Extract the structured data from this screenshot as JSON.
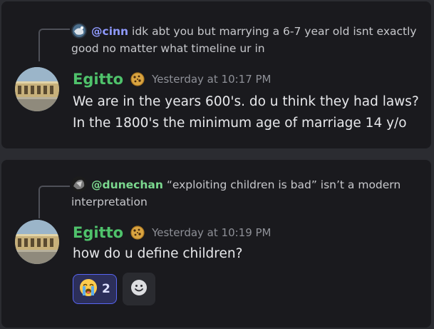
{
  "messages": [
    {
      "reply": {
        "mention": "@cinn",
        "text": "idk abt you but marrying a 6-7 year old isnt exactly good no matter what timeline ur in"
      },
      "author": "Egitto",
      "timestamp": "Yesterday at 10:17 PM",
      "content_lines": [
        "We are in the years 600's. do u think they had laws?",
        "In the 1800's the minimum age of marriage 14 y/o"
      ]
    },
    {
      "reply": {
        "mention": "@dunechan",
        "text": "“exploiting children is bad” isn’t a modern interpretation"
      },
      "author": "Egitto",
      "timestamp": "Yesterday at 10:19 PM",
      "content_lines": [
        "how do u define children?"
      ],
      "reactions": [
        {
          "emoji": "loudly-crying-face",
          "count": "2"
        }
      ]
    }
  ],
  "icons": {
    "author_badge": "cookie-icon",
    "add_reaction": "smiley-icon"
  },
  "colors": {
    "background": "#2b2c31",
    "card": "#1a1a1e",
    "username": "#4fc26b",
    "mention_blue": "#8f9aff",
    "mention_green": "#7bd88f",
    "reaction_border": "#5865f2"
  }
}
